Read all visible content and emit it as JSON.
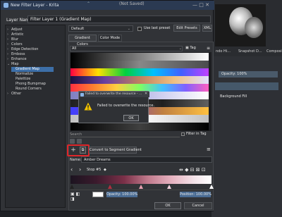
{
  "dialog": {
    "title": "New Filter Layer - Krita",
    "background_title": "(Not Saved)",
    "layer_name_label": "Layer Name:",
    "layer_name_value": "Filter Layer 1 (Gradient Map)"
  },
  "filter_tree": [
    {
      "label": "Adjust",
      "arrow": "›"
    },
    {
      "label": "Artistic",
      "arrow": "›"
    },
    {
      "label": "Blur",
      "arrow": "›"
    },
    {
      "label": "Colors",
      "arrow": "›"
    },
    {
      "label": "Edge Detection",
      "arrow": "›"
    },
    {
      "label": "Emboss",
      "arrow": "›"
    },
    {
      "label": "Enhance",
      "arrow": "›"
    },
    {
      "label": "Map",
      "arrow": "⌄"
    },
    {
      "label": "Gradient Map",
      "arrow": ""
    },
    {
      "label": "Normalize",
      "arrow": ""
    },
    {
      "label": "Palettize",
      "arrow": ""
    },
    {
      "label": "Phong Bumpmap",
      "arrow": ""
    },
    {
      "label": "Round Corners",
      "arrow": ""
    },
    {
      "label": "Other",
      "arrow": "›"
    }
  ],
  "preset": {
    "value": "Default"
  },
  "use_last_preset": "Use last preset",
  "edit_presets": "Edit Presets",
  "xml": "XML",
  "tabs": {
    "gradient_colors": "Gradient Colors",
    "color_mode": "Color Mode"
  },
  "tag_dropdown": "All",
  "tag_button": "Tag",
  "search_placeholder": "Search",
  "filter_in_tag": "Filter in Tag",
  "convert_button": "Convert to Segment Gradient",
  "name_label": "Name:",
  "name_value": "Amber Dreams",
  "stop_label": "Stop #5",
  "opacity_field": "Opacity: 100.00%",
  "position_field": "Position: 100.00%",
  "ok_main": "OK",
  "cancel_main": "Cancel",
  "error": {
    "title": "Failed to overwrite the resource - ...",
    "message": "Failed to overwrite the resource.",
    "ok": "OK"
  },
  "background": {
    "tabs": [
      "ndo Hi...",
      "Snapshot D...",
      "Composi..."
    ],
    "opacity": "Opacity: 100%",
    "layer_name": "Background Fill"
  },
  "gradients": [
    "linear-gradient(90deg,#000,#fff)",
    "linear-gradient(90deg,#000 0%,#888 50%,rgba(255,255,255,0.2) 100%)",
    "linear-gradient(90deg,#ff0040,#ffe000,#00d040,#00c0ff,#4060ff,#c040ff)",
    "linear-gradient(90deg,#1a1040,#6a40a0,#c08060,#f0c080,#e0e0ff)",
    "linear-gradient(90deg,#ff3040,#ff8030,#ffd040,#80ff60,#40c0ff,#8060ff,#ff60c0)",
    "linear-gradient(90deg,#8080c0,#a0a0e0,#d0d0f0,#ffffff)",
    "linear-gradient(90deg,#202020,#404040,#202020,#606060)",
    "linear-gradient(90deg,#4040ff,#8040c0,#c08040,#ffc040)",
    "linear-gradient(90deg,#c0c0c0,#ffffff,#c0c0c0)",
    "linear-gradient(90deg,#000,#404040,#000)"
  ],
  "colors": {
    "accent": "#3d6fa8",
    "highlight": "#e0262a",
    "warning": "#f2c200"
  }
}
